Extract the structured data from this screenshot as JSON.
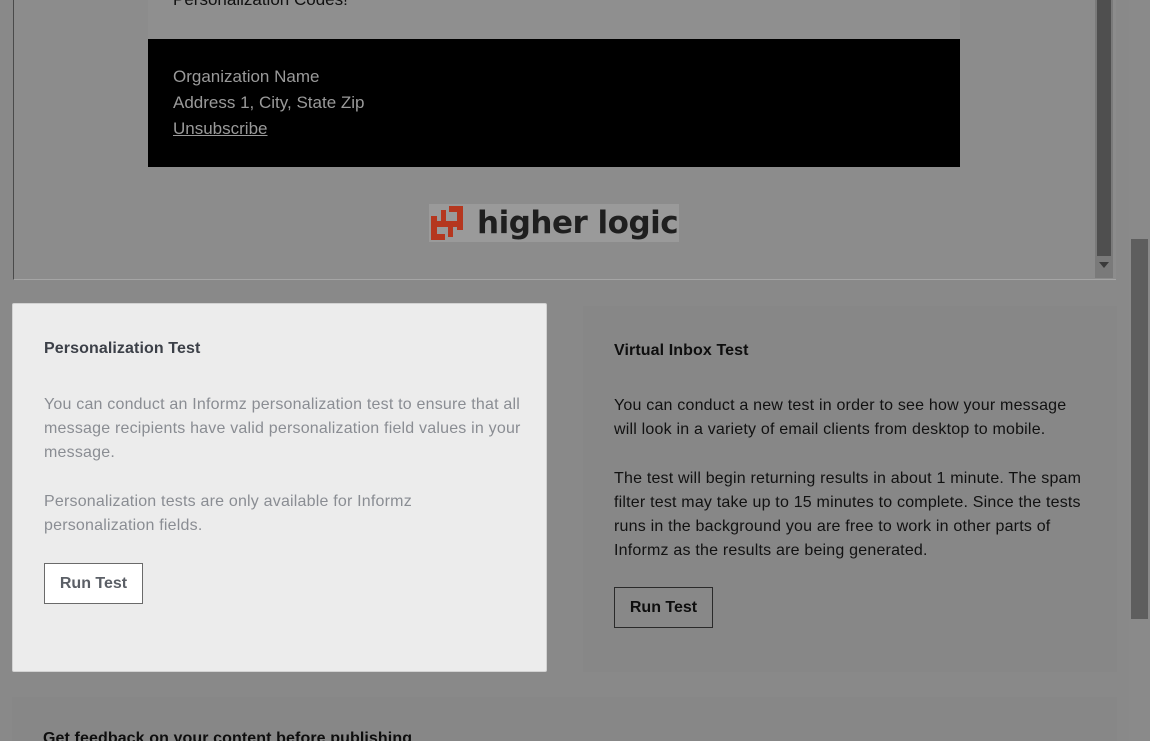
{
  "preview": {
    "top_text": "Personalization Codes!",
    "footer": {
      "org_name": "Organization Name",
      "address": "Address 1, City, State Zip",
      "unsubscribe": "Unsubscribe"
    },
    "logo_text": "higher logic"
  },
  "personalization_test": {
    "title": "Personalization Test",
    "paragraph1": "You can conduct an Informz personalization test to ensure that all message recipients have valid personalization field values in your message.",
    "paragraph2": "Personalization tests are only available for Informz personalization fields.",
    "button": "Run Test"
  },
  "virtual_inbox_test": {
    "title": "Virtual Inbox Test",
    "paragraph1": "You can conduct a new test in order to see how your message will look in a variety of email clients from desktop to mobile.",
    "paragraph2": "The test will begin returning results in about 1 minute. The spam filter test may take up to 15 minutes to complete. Since the tests runs in the background you are free to work in other parts of Informz as the results are being generated.",
    "button": "Run Test"
  },
  "feedback": {
    "title": "Get feedback on your content before publishing"
  },
  "colors": {
    "overlay": "#898989",
    "logo_accent": "#c0392b",
    "active_card": "#ececec"
  }
}
